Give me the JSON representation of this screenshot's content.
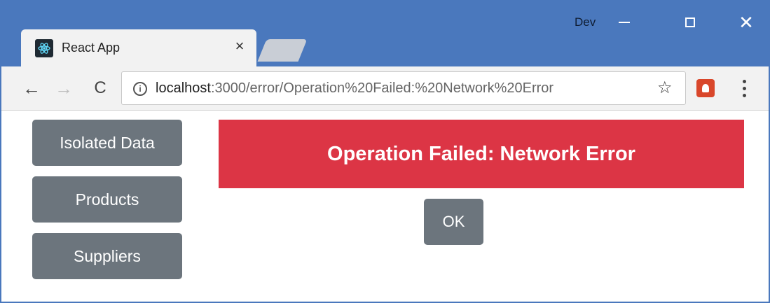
{
  "browser": {
    "tab_title": "React App",
    "user_label": "Dev",
    "url_host": "localhost",
    "url_rest": ":3000/error/Operation%20Failed:%20Network%20Error",
    "colors": {
      "titlebar": "#4a78bd",
      "toolbar": "#f2f2f2"
    }
  },
  "sidebar": {
    "items": [
      {
        "label": "Isolated Data"
      },
      {
        "label": "Products"
      },
      {
        "label": "Suppliers"
      }
    ]
  },
  "error": {
    "message": "Operation Failed: Network Error",
    "ok_label": "OK",
    "colors": {
      "alert": "#dc3545",
      "button": "#6c757d"
    }
  }
}
